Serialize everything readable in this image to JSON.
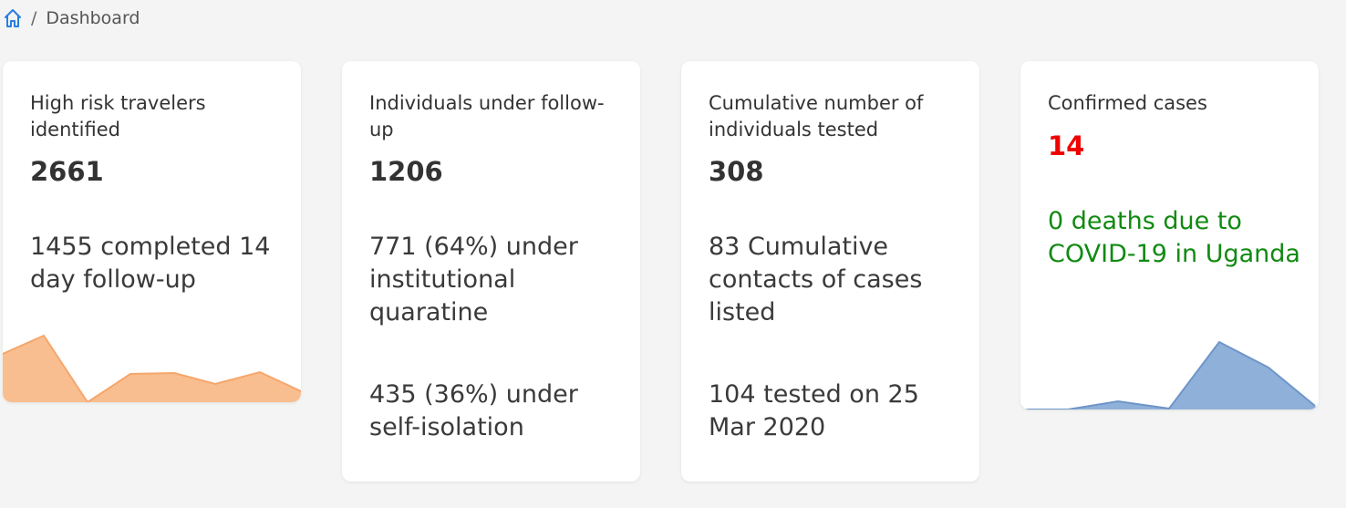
{
  "breadcrumb": {
    "home_icon": "home-icon",
    "separator": "/",
    "current": "Dashboard"
  },
  "cards": [
    {
      "title": "High risk travelers identified",
      "value": "2661",
      "sub1": "1455 completed 14 day follow-up",
      "chart_color": "#f9be8f"
    },
    {
      "title": "Individuals under follow-up",
      "value": "1206",
      "sub1": "771 (64%) under institutional quaratine",
      "sub2": "435 (36%) under self-isolation"
    },
    {
      "title": "Cumulative number of individuals tested",
      "value": "308",
      "sub1": "83 Cumulative contacts of cases listed",
      "sub2": "104 tested on 25 Mar 2020"
    },
    {
      "title": "Confirmed cases",
      "value": "14",
      "value_color": "#ee0000",
      "sub1": "0 deaths due to COVID-19 in Uganda",
      "sub1_color": "#118a11",
      "chart_color": "#8fb0d8"
    }
  ]
}
